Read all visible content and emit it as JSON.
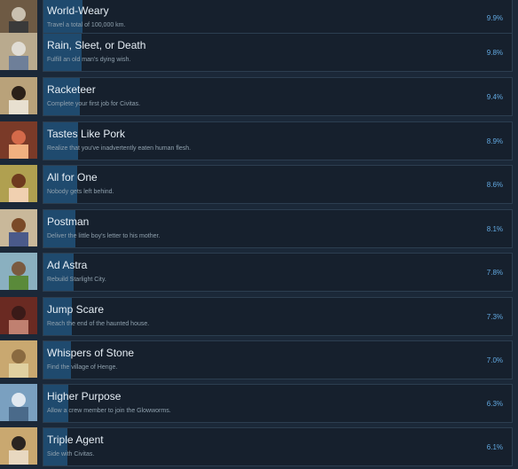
{
  "achievements": [
    {
      "title": "World-Weary",
      "description": "Travel a total of 100,000 km.",
      "percent": "9.9%",
      "fraction": 0.099,
      "icon": "traveler-portrait-icon",
      "colors": [
        "#6e5a44",
        "#c9c0b0",
        "#3a3a3a"
      ]
    },
    {
      "title": "Rain, Sleet, or Death",
      "description": "Fulfill an old man's dying wish.",
      "percent": "9.8%",
      "fraction": 0.098,
      "icon": "old-man-portrait-icon",
      "colors": [
        "#b9aa8e",
        "#e0dcd4",
        "#6e7f99"
      ]
    },
    {
      "title": "Racketeer",
      "description": "Complete your first job for Civitas.",
      "percent": "9.4%",
      "fraction": 0.094,
      "icon": "mobster-portrait-icon",
      "colors": [
        "#b9a27a",
        "#2a2018",
        "#e8e0d0"
      ]
    },
    {
      "title": "Tastes Like Pork",
      "description": "Realize that you've inadvertently eaten human flesh.",
      "percent": "8.9%",
      "fraction": 0.089,
      "icon": "roast-meat-icon",
      "colors": [
        "#7a3a28",
        "#d46a4a",
        "#f0b080"
      ]
    },
    {
      "title": "All for One",
      "description": "Nobody gets left behind.",
      "percent": "8.6%",
      "fraction": 0.086,
      "icon": "girl-portrait-icon",
      "colors": [
        "#b0a050",
        "#6e3a1e",
        "#f0d0b0"
      ]
    },
    {
      "title": "Postman",
      "description": "Deliver the little boy's letter to his mother.",
      "percent": "8.1%",
      "fraction": 0.081,
      "icon": "boy-portrait-icon",
      "colors": [
        "#c9b89a",
        "#7a4a28",
        "#4a5a8a"
      ]
    },
    {
      "title": "Ad Astra",
      "description": "Rebuild Starlight City.",
      "percent": "7.8%",
      "fraction": 0.078,
      "icon": "city-wall-icon",
      "colors": [
        "#8ab0c0",
        "#7a5a40",
        "#5a8a3a"
      ]
    },
    {
      "title": "Jump Scare",
      "description": "Reach the end of the haunted house.",
      "percent": "7.3%",
      "fraction": 0.073,
      "icon": "haunted-house-icon",
      "colors": [
        "#6a2a22",
        "#3a1a18",
        "#c08070"
      ]
    },
    {
      "title": "Whispers of Stone",
      "description": "Find the village of Henge.",
      "percent": "7.0%",
      "fraction": 0.07,
      "icon": "stone-village-icon",
      "colors": [
        "#c9a870",
        "#8a6a40",
        "#e0d0a0"
      ]
    },
    {
      "title": "Higher Purpose",
      "description": "Allow a crew member to join the Glowworms.",
      "percent": "6.3%",
      "fraction": 0.063,
      "icon": "glowworm-hall-icon",
      "colors": [
        "#7aa0c0",
        "#e0e8f0",
        "#4a6a8a"
      ]
    },
    {
      "title": "Triple Agent",
      "description": "Side with Civitas.",
      "percent": "6.1%",
      "fraction": 0.061,
      "icon": "agent-portrait-icon",
      "colors": [
        "#c9a870",
        "#2a2420",
        "#e8d8c0"
      ]
    }
  ],
  "colors": {
    "background": "#1b2838",
    "panel": "#16202d",
    "progress": "#1f4a6e",
    "percent_text": "#62a8e0"
  }
}
